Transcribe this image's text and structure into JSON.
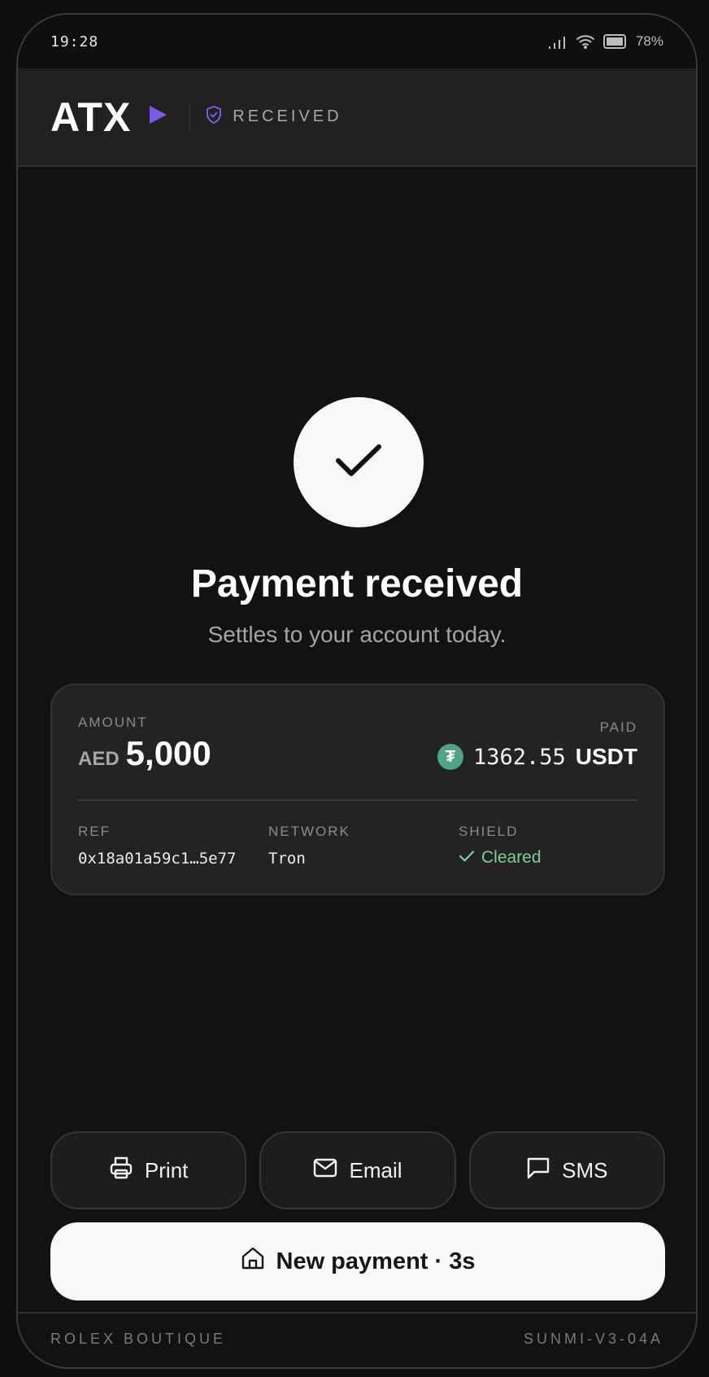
{
  "status_bar": {
    "time": "19:28",
    "battery": "78%"
  },
  "header": {
    "logo": "ATX",
    "status": "RECEIVED"
  },
  "main": {
    "title": "Payment received",
    "subtitle": "Settles to your account today."
  },
  "card": {
    "amount_label": "AMOUNT",
    "amount_currency": "AED",
    "amount_value": "5,000",
    "paid_label": "PAID",
    "paid_value": "1362.55",
    "paid_currency": "USDT",
    "token_symbol": "₮",
    "ref_label": "REF",
    "ref_value": "0x18a01a59c1…5e77",
    "network_label": "NETWORK",
    "network_value": "Tron",
    "shield_label": "SHIELD",
    "shield_value": "Cleared"
  },
  "actions": {
    "print_label": "Print",
    "email_label": "Email",
    "sms_label": "SMS",
    "new_payment_label": "New payment · 3s"
  },
  "footer": {
    "merchant": "ROLEX BOUTIQUE",
    "device_id": "SUNMI-V3-04A"
  },
  "colors": {
    "accent": "#7c5ce6",
    "success": "#7ccf98",
    "token": "#4fa483"
  }
}
